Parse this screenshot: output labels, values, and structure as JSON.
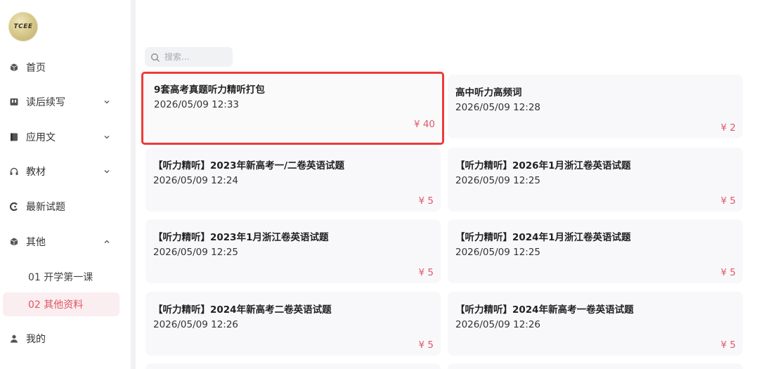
{
  "sidebar": {
    "logo_text": "TCEE",
    "items": [
      {
        "label": "首页",
        "icon": "cube-icon"
      },
      {
        "label": "读后续写",
        "icon": "book-icon"
      },
      {
        "label": "应用文",
        "icon": "box-icon"
      },
      {
        "label": "教材",
        "icon": "headphones-icon"
      },
      {
        "label": "最新试题",
        "icon": "swirl-icon"
      },
      {
        "label": "其他",
        "icon": "cube-icon"
      }
    ],
    "sub_items": [
      {
        "label": "01 开学第一课"
      },
      {
        "label": "02 其他资料"
      }
    ],
    "profile": {
      "label": "我的",
      "icon": "user-icon"
    }
  },
  "search": {
    "placeholder": "搜索..."
  },
  "cards": [
    {
      "title": "9套高考真题听力精听打包",
      "date": "2026/05/09 12:33",
      "price": "¥ 40"
    },
    {
      "title": "高中听力高频词",
      "date": "2026/05/09 12:28",
      "price": "¥ 2"
    },
    {
      "title": "【听力精听】2023年新高考一/二卷英语试题",
      "date": "2026/05/09 12:24",
      "price": "¥ 5"
    },
    {
      "title": "【听力精听】2026年1月浙江卷英语试题",
      "date": "2026/05/09 12:25",
      "price": "¥ 5"
    },
    {
      "title": "【听力精听】2023年1月浙江卷英语试题",
      "date": "2026/05/09 12:25",
      "price": "¥ 5"
    },
    {
      "title": "【听力精听】2024年1月浙江卷英语试题",
      "date": "2026/05/09 12:25",
      "price": "¥ 5"
    },
    {
      "title": "【听力精听】2024年新高考二卷英语试题",
      "date": "2026/05/09 12:26",
      "price": "¥ 5"
    },
    {
      "title": "【听力精听】2024年新高考一卷英语试题",
      "date": "2026/05/09 12:26",
      "price": "¥ 5"
    }
  ],
  "colors": {
    "accent": "#e05561",
    "highlight_border": "#ee3b3b",
    "card_bg": "#f8f8fa"
  }
}
